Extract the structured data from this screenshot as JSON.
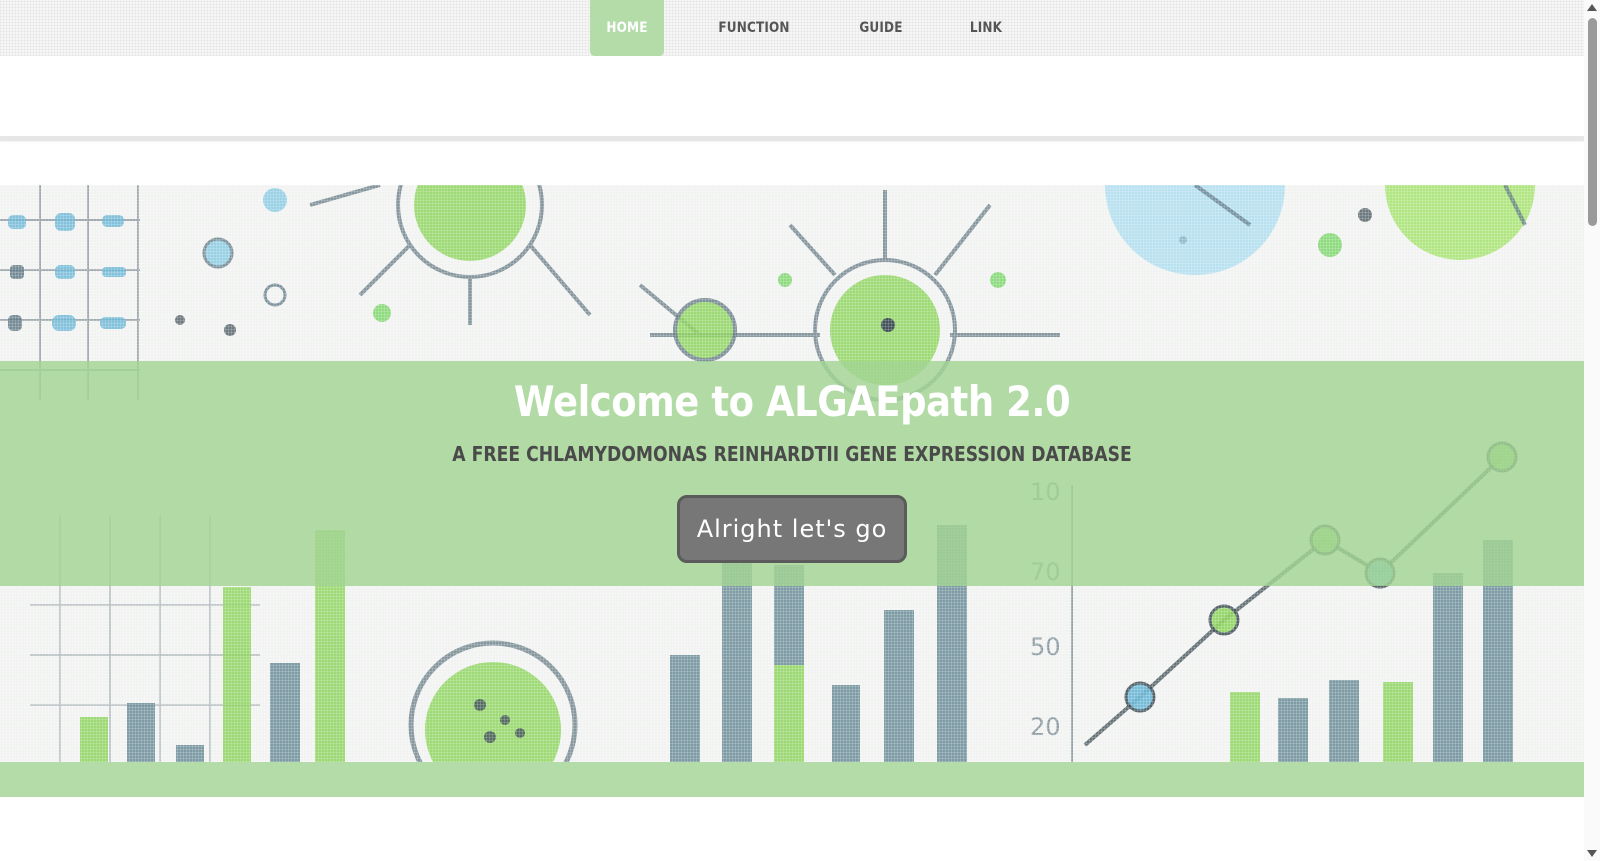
{
  "nav": {
    "items": [
      {
        "label": "HOME",
        "active": true
      },
      {
        "label": "FUNCTION",
        "active": false
      },
      {
        "label": "GUIDE",
        "active": false
      },
      {
        "label": "LINK",
        "active": false
      }
    ]
  },
  "hero": {
    "title": "Welcome to ALGAEpath 2.0",
    "subtitle": "A FREE CHLAMYDOMONAS REINHARDTII GENE EXPRESSION DATABASE",
    "cta_label": "Alright let's go",
    "background_axis_labels": [
      "10",
      "70",
      "50",
      "20"
    ]
  },
  "colors": {
    "accent_green": "#b3dca9",
    "band_green": "#a2d494",
    "button_gray": "#777777",
    "title_white": "#ffffff"
  }
}
